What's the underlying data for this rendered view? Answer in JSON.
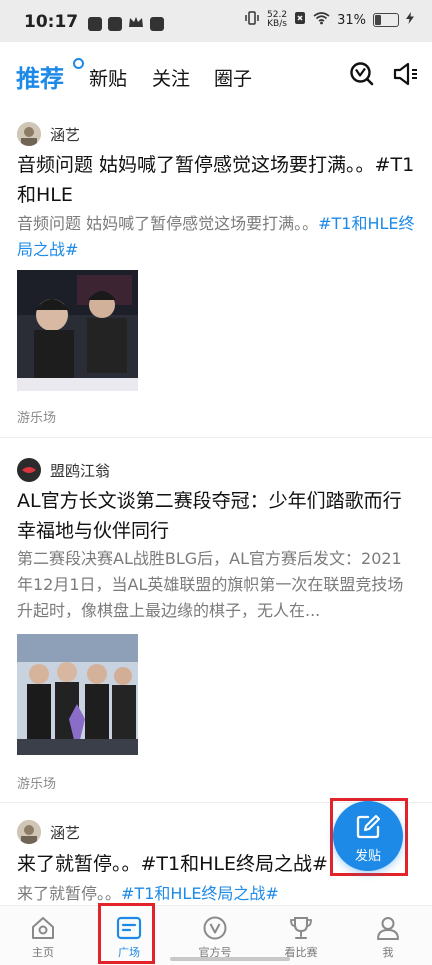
{
  "status_bar": {
    "time": "10:17",
    "net_speed_value": "52.2",
    "net_speed_unit": "KB/s",
    "battery": "31%"
  },
  "top_tabs": [
    {
      "label": "推荐",
      "active": true
    },
    {
      "label": "新贴",
      "active": false
    },
    {
      "label": "关注",
      "active": false
    },
    {
      "label": "圈子",
      "active": false
    }
  ],
  "posts": [
    {
      "author": "涵艺",
      "title": "音频问题 姑妈喊了暂停感觉这场要打满。。#T1和HLE",
      "summary_text": "音频问题 姑妈喊了暂停感觉这场要打满。。",
      "summary_tag": "#T1和HLE终局之战#",
      "source": "游乐场"
    },
    {
      "author": "盟鸥江翁",
      "title": "AL官方长文谈第二赛段夺冠：少年们踏歌而行幸福地与伙伴同行",
      "summary_text": " 第二赛段决赛AL战胜BLG后，AL官方赛后发文：2021年12月1日，当AL英雄联盟的旗帜第一次在联盟竞技场升起时，像棋盘上最边缘的棋子，无人在...",
      "source": "游乐场"
    },
    {
      "author": "涵艺",
      "title": "来了就暂停。。#T1和HLE终局之战#",
      "summary_text": "来了就暂停。。",
      "summary_tag": "#T1和HLE终局之战#"
    }
  ],
  "fab": {
    "label": "发贴"
  },
  "bottom_nav": [
    {
      "label": "主页",
      "icon": "home-icon",
      "active": false
    },
    {
      "label": "广场",
      "icon": "square-icon",
      "active": true
    },
    {
      "label": "官方号",
      "icon": "official-v-icon",
      "active": false
    },
    {
      "label": "看比赛",
      "icon": "trophy-icon",
      "active": false
    },
    {
      "label": "我",
      "icon": "profile-icon",
      "active": false
    }
  ],
  "colors": {
    "accent": "#1d8ae8",
    "highlight_box": "#e2232a"
  }
}
